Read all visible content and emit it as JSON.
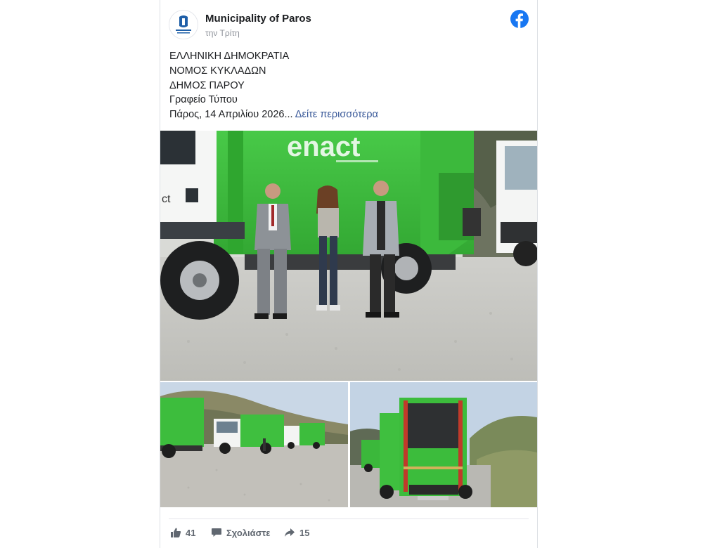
{
  "post": {
    "page_name": "Municipality of Paros",
    "time": "την Τρίτη",
    "avatar_alt": "MUNICIPALITY PAROS",
    "text_lines": [
      "ΕΛΛΗΝΙΚΗ ΔΗΜΟΚΡΑΤΙΑ",
      "ΝΟΜΟΣ ΚΥΚΛΑΔΩΝ",
      "ΔΗΜΟΣ ΠΑΡΟΥ",
      "Γραφείο Τύπου",
      "Πάρος, 14 Απριλίου 2026..."
    ],
    "see_more": "Δείτε περισσότερα"
  },
  "photos": {
    "main_truck_brand": "enact",
    "cab_brand": "ct"
  },
  "actions": {
    "like_count": "41",
    "comment_label": "Σχολιάστε",
    "share_count": "15"
  },
  "colors": {
    "facebook_blue": "#1877f2",
    "link_blue": "#385898",
    "truck_green": "#3fbf3a",
    "muted_text": "#606770"
  }
}
